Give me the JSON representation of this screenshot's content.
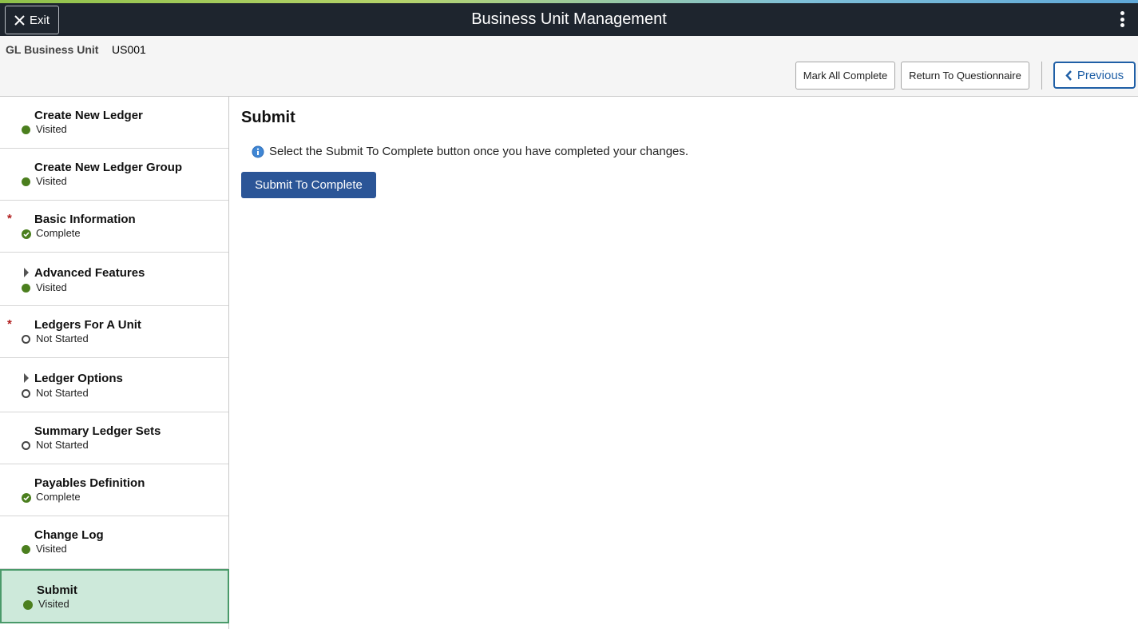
{
  "header": {
    "exit_label": "Exit",
    "title": "Business Unit Management",
    "menu_icon": "kebab-menu-icon"
  },
  "subheader": {
    "business_unit_label": "GL Business Unit",
    "business_unit_value": "US001",
    "mark_all_complete_label": "Mark All Complete",
    "return_label": "Return To Questionnaire",
    "previous_label": "Previous"
  },
  "sidebar": {
    "steps": [
      {
        "title": "Create New Ledger",
        "status": "Visited",
        "status_type": "visited",
        "required": false,
        "expandable": false
      },
      {
        "title": "Create New Ledger Group",
        "status": "Visited",
        "status_type": "visited",
        "required": false,
        "expandable": false
      },
      {
        "title": "Basic Information",
        "status": "Complete",
        "status_type": "complete",
        "required": true,
        "expandable": false
      },
      {
        "title": "Advanced Features",
        "status": "Visited",
        "status_type": "visited",
        "required": false,
        "expandable": true
      },
      {
        "title": "Ledgers For A Unit",
        "status": "Not Started",
        "status_type": "not-started",
        "required": true,
        "expandable": false
      },
      {
        "title": "Ledger Options",
        "status": "Not Started",
        "status_type": "not-started",
        "required": false,
        "expandable": true
      },
      {
        "title": "Summary Ledger Sets",
        "status": "Not Started",
        "status_type": "not-started",
        "required": false,
        "expandable": false
      },
      {
        "title": "Payables Definition",
        "status": "Complete",
        "status_type": "complete",
        "required": false,
        "expandable": false
      },
      {
        "title": "Change Log",
        "status": "Visited",
        "status_type": "visited",
        "required": false,
        "expandable": false
      },
      {
        "title": "Submit",
        "status": "Visited",
        "status_type": "visited",
        "required": false,
        "expandable": false,
        "selected": true
      }
    ],
    "required_marker": "*"
  },
  "main": {
    "title": "Submit",
    "info_text": "Select the Submit To Complete button once you have completed your changes.",
    "submit_label": "Submit To Complete"
  },
  "colors": {
    "topbar": "#1e252e",
    "primary_button": "#2b5597",
    "link_blue": "#1f5fa6",
    "status_green": "#4b7f1e",
    "selected_step_bg": "#cde9da",
    "required_red": "#b01c1c"
  }
}
